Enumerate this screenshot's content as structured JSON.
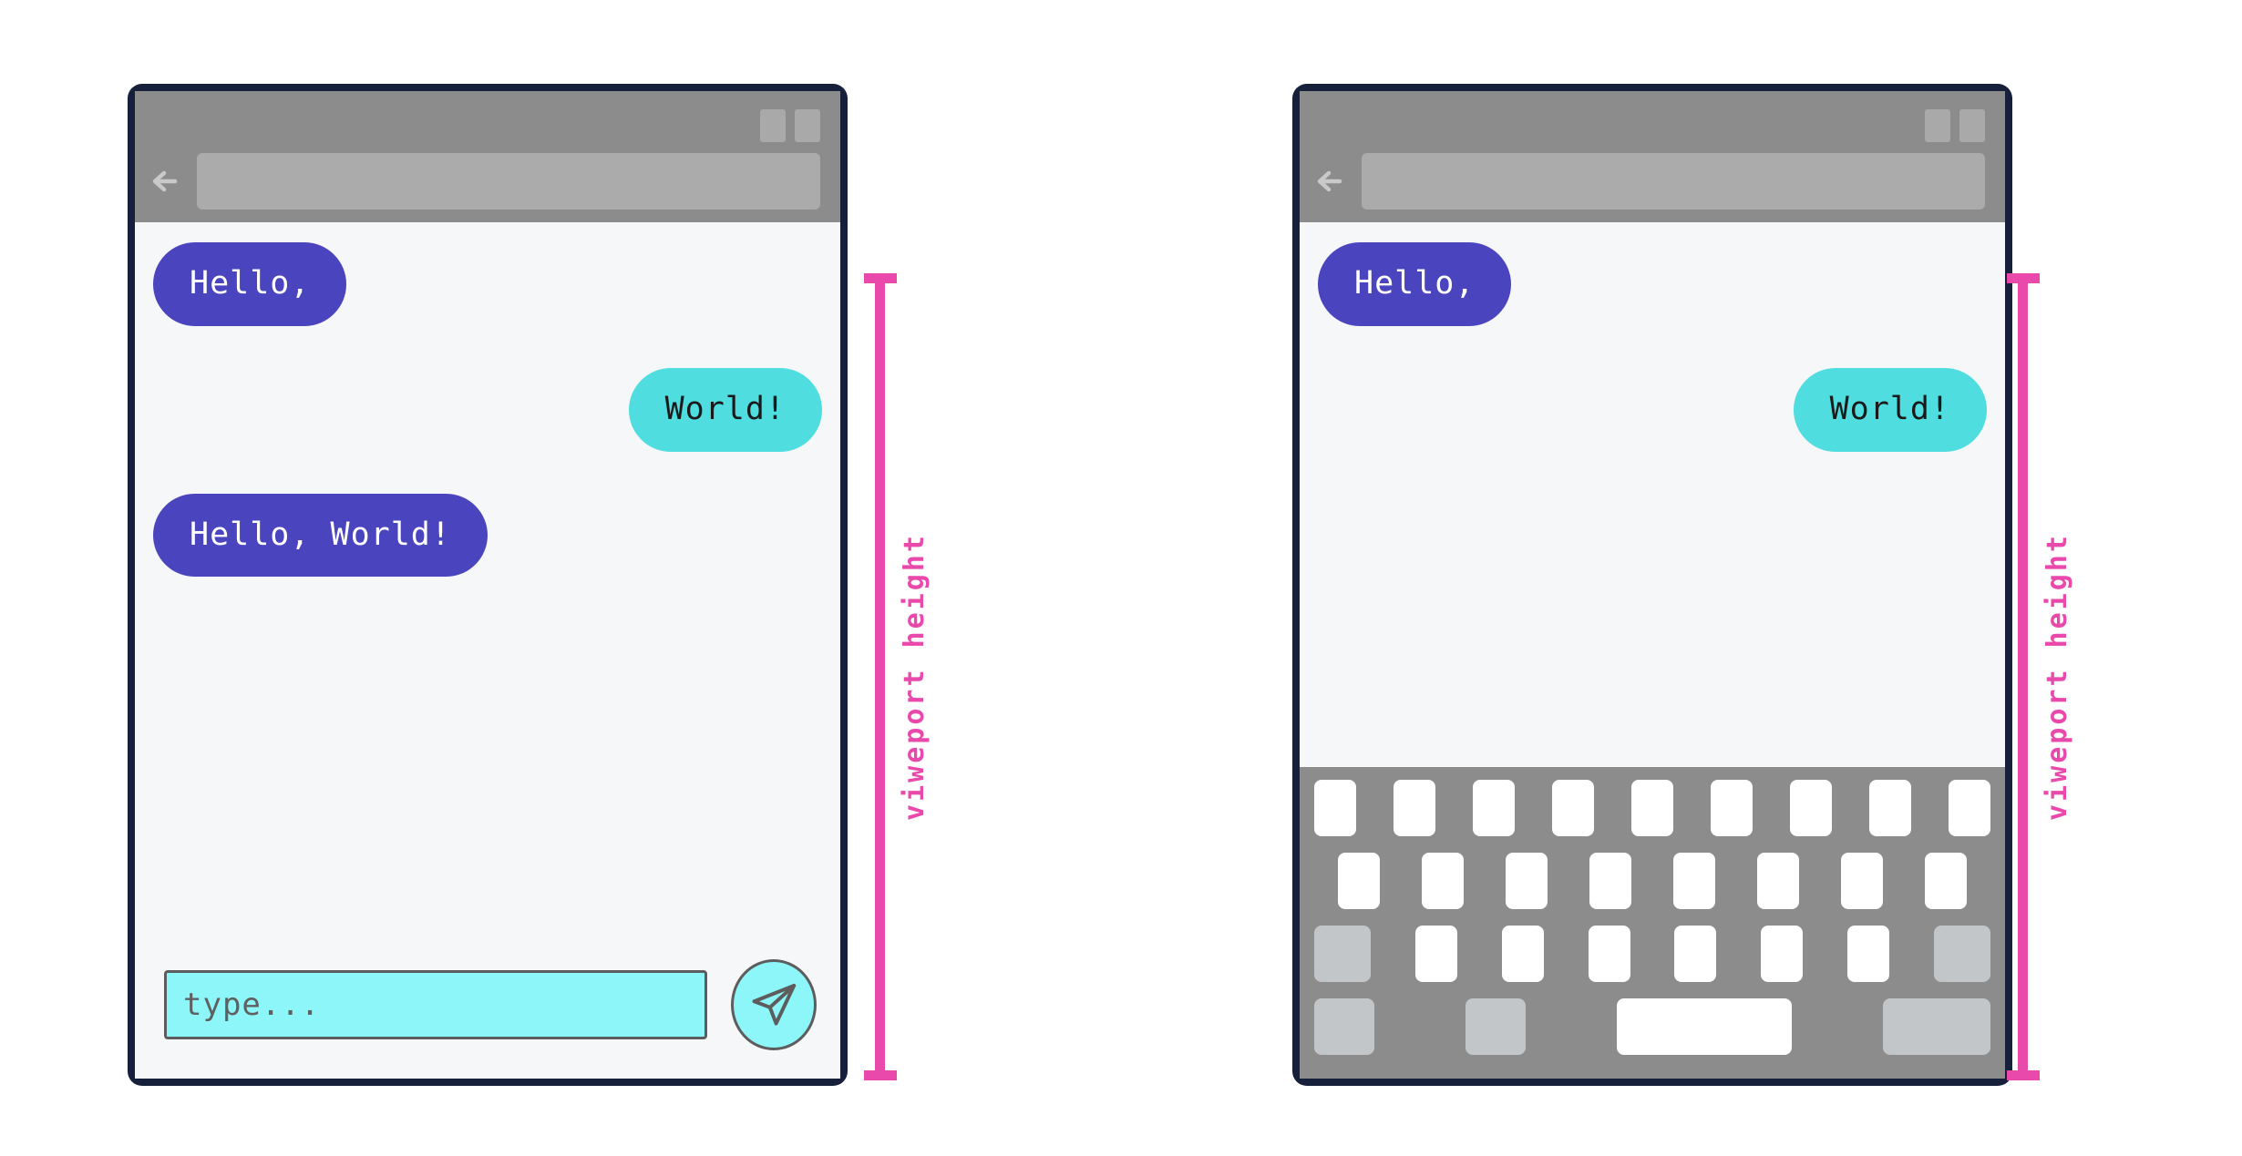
{
  "colors": {
    "phone_frame": "#16203a",
    "screen_bg": "#f6f7f8",
    "chrome_gray": "#8c8c8c",
    "url_bar_gray": "#ababab",
    "bubble_them": "#4a44be",
    "bubble_me": "#4fdde0",
    "input_cyan": "#8cf6f9",
    "annotation_pink": "#ea49ac",
    "key_white": "#ffffff",
    "key_mod_gray": "#c3c6c8"
  },
  "panels": [
    {
      "id": "keyboard-closed",
      "chrome": {
        "back_icon": "back-arrow-icon",
        "url_bar_value": "",
        "tab_chips": [
          "tab-chip-1",
          "tab-chip-2"
        ]
      },
      "messages": [
        {
          "side": "them",
          "text": "Hello,"
        },
        {
          "side": "me",
          "text": "World!"
        },
        {
          "side": "them",
          "text": "Hello, World!"
        }
      ],
      "composer": {
        "visible": true,
        "input_placeholder": "type...",
        "input_value": "",
        "send_icon": "send-paper-plane-icon"
      },
      "keyboard": {
        "visible": false
      },
      "annotation": {
        "label": "viweport height"
      }
    },
    {
      "id": "keyboard-open",
      "chrome": {
        "back_icon": "back-arrow-icon",
        "url_bar_value": "",
        "tab_chips": [
          "tab-chip-1",
          "tab-chip-2"
        ]
      },
      "messages": [
        {
          "side": "them",
          "text": "Hello,"
        },
        {
          "side": "me",
          "text": "World!"
        }
      ],
      "composer": {
        "visible": false
      },
      "keyboard": {
        "visible": true,
        "rows": [
          {
            "keys": [
              "alpha",
              "alpha",
              "alpha",
              "alpha",
              "alpha",
              "alpha",
              "alpha",
              "alpha",
              "alpha"
            ]
          },
          {
            "keys": [
              "alpha",
              "alpha",
              "alpha",
              "alpha",
              "alpha",
              "alpha",
              "alpha",
              "alpha"
            ]
          },
          {
            "keys": [
              "mod",
              "alpha",
              "alpha",
              "alpha",
              "alpha",
              "alpha",
              "alpha",
              "mod"
            ]
          },
          {
            "keys": [
              "wide",
              "wide",
              "space",
              "enter"
            ]
          }
        ]
      },
      "annotation": {
        "label": "viweport height"
      }
    }
  ]
}
